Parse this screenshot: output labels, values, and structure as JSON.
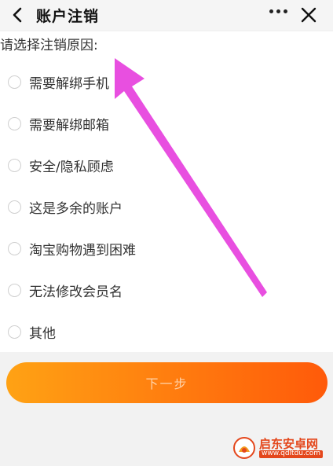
{
  "header": {
    "title": "账户注销",
    "back_icon": "chevron-left-icon",
    "more_icon": "more-dots-icon",
    "close_icon": "close-icon"
  },
  "form": {
    "prompt": "请选择注销原因:",
    "options": [
      {
        "label": "需要解绑手机"
      },
      {
        "label": "需要解绑邮箱"
      },
      {
        "label": "安全/隐私顾虑"
      },
      {
        "label": "这是多余的账户"
      },
      {
        "label": "淘宝购物遇到困难"
      },
      {
        "label": "无法修改会员名"
      },
      {
        "label": "其他"
      }
    ]
  },
  "footer": {
    "next_label": "下一步"
  },
  "colors": {
    "button_start": "#ffa214",
    "button_end": "#ff5a0a",
    "annotation_arrow": "#e84fe0"
  },
  "watermark": {
    "name": "启东安卓网",
    "url": "www.qdltdu.com"
  }
}
